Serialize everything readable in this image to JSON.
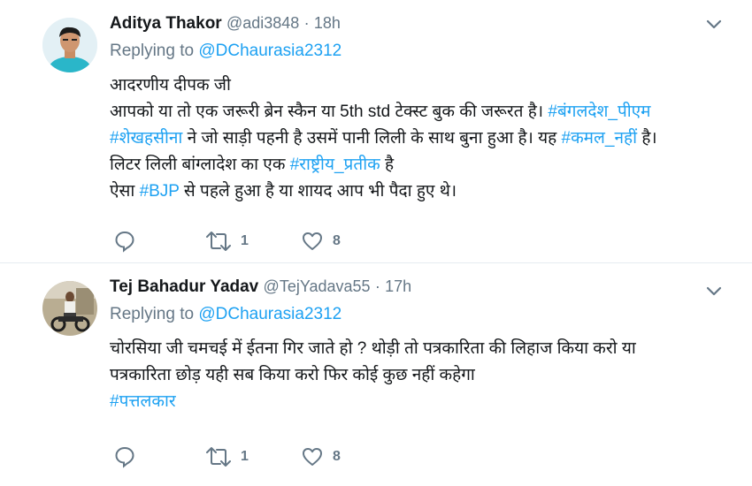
{
  "tweets": [
    {
      "name": "Aditya Thakor",
      "handle": "@adi3848",
      "sep": "·",
      "time": "18h",
      "replying_prefix": "Replying to",
      "replying_to": "@DChaurasia2312",
      "lines": {
        "l1": "आदरणीय दीपक जी",
        "l2a": "आपको या तो एक जरूरी ब्रेन स्कैन या 5th std टेक्स्ट बुक की जरूरत है। ",
        "l2b": "#बंगलदेश_पीएम",
        "l3a": "#शेखहसीना",
        "l3b": " ने जो साड़ी पहनी है उसमें पानी लिली के साथ बुना हुआ है।  यह ",
        "l3c": "#कमल_नहीं",
        "l3d": " है।",
        "l4a": "लिटर लिली बांग्लादेश का एक ",
        "l4b": "#राष्ट्रीय_प्रतीक",
        "l4c": " है",
        "l5a": "ऐसा ",
        "l5b": "#BJP",
        "l5c": " से पहले हुआ है या शायद आप भी पैदा हुए थे।"
      },
      "retweets": "1",
      "likes": "8"
    },
    {
      "name": "Tej Bahadur Yadav",
      "handle": "@TejYadava55",
      "sep": "·",
      "time": "17h",
      "replying_prefix": "Replying to",
      "replying_to": "@DChaurasia2312",
      "lines": {
        "l1": "चोरसिया जी चमचई में ईतना गिर जाते हो ? थोड़ी तो पत्रकारिता की लिहाज किया करो या",
        "l2": "पत्रकारिता छोड़ यही सब किया करो फिर कोई कुछ नहीं कहेगा",
        "l3": "#पत्तलकार"
      },
      "retweets": "1",
      "likes": "8"
    }
  ],
  "colors": {
    "link": "#1da1f2",
    "muted": "#657786",
    "divider": "#e6ecf0"
  },
  "icons": [
    "reply-icon",
    "retweet-icon",
    "like-icon",
    "chevron-down-icon"
  ]
}
